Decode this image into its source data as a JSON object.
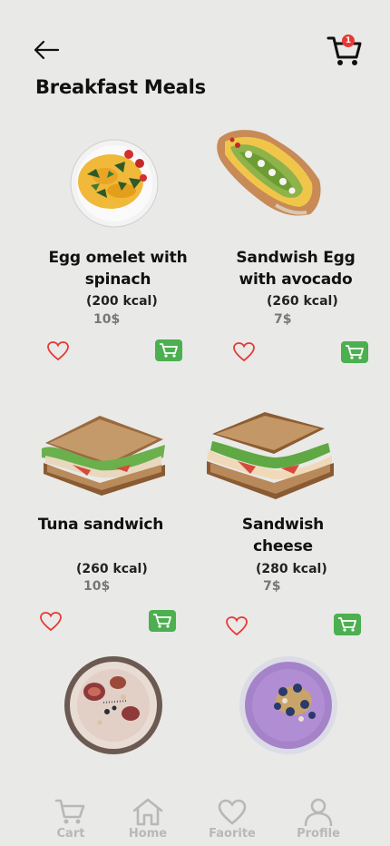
{
  "header": {
    "title": "Breakfast Meals",
    "cart_badge": "1"
  },
  "meals": [
    {
      "name": "Egg omelet with spinach",
      "kcal": "(200 kcal)",
      "price": "10$"
    },
    {
      "name": "Sandwish Egg with avocado",
      "kcal": "(260 kcal)",
      "price": "7$"
    },
    {
      "name": "Tuna sandwich",
      "kcal": "(260 kcal)",
      "price": "10$"
    },
    {
      "name": "Sandwish cheese",
      "kcal": "(280 kcal)",
      "price": "7$"
    }
  ],
  "nav": {
    "cart": "Cart",
    "home": "Home",
    "favorite": "Faorite",
    "profile": "Profile"
  },
  "colors": {
    "background": "#e9e9e7",
    "accent_green": "#4caf50",
    "heart_red": "#e53935",
    "nav_gray": "#b8b8b8"
  },
  "icons": [
    "back-arrow-icon",
    "cart-icon",
    "heart-icon",
    "add-to-cart-icon",
    "home-icon",
    "profile-icon"
  ]
}
